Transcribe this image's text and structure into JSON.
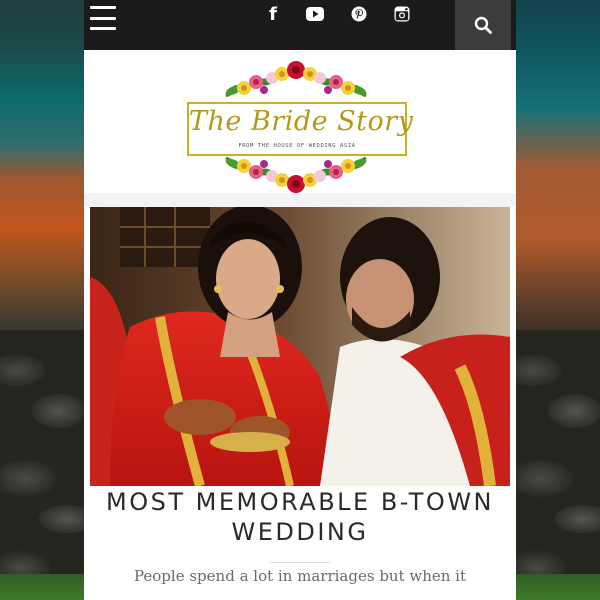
{
  "header": {
    "menu_icon": "hamburger-icon",
    "social": [
      {
        "name": "facebook",
        "icon": "facebook-icon",
        "glyph": "f"
      },
      {
        "name": "youtube",
        "icon": "youtube-icon"
      },
      {
        "name": "pinterest",
        "icon": "pinterest-icon"
      },
      {
        "name": "instagram",
        "icon": "instagram-icon"
      }
    ],
    "search_icon": "search-icon"
  },
  "logo": {
    "title": "The Bride Story",
    "subtitle": "FROM THE HOUSE OF WEDDING ASIA",
    "border_color": "#c7b22a",
    "text_color": "#b59a1a"
  },
  "post": {
    "image": "wedding-photo",
    "title": "MOST MEMORABLE B-TOWN WEDDING",
    "excerpt": "People spend a lot in marriages but when it"
  },
  "colors": {
    "topbar": "#1b1b1b",
    "search_bg": "#3c3c3c",
    "saree_red": "#d6201a"
  }
}
